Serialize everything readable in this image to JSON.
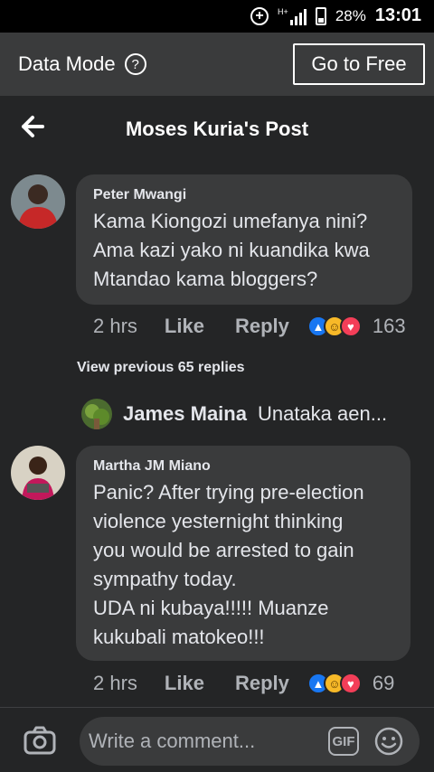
{
  "status_bar": {
    "network": "H+",
    "battery": "28%",
    "time": "13:01"
  },
  "data_bar": {
    "label": "Data Mode",
    "help_glyph": "?",
    "go_free": "Go to Free"
  },
  "header": {
    "title": "Moses Kuria's Post"
  },
  "comments": [
    {
      "author": "Peter Mwangi",
      "lines": [
        "Kama Kiongozi umefanya nini?",
        "Ama kazi yako ni kuandika kwa",
        "Mtandao kama bloggers?"
      ],
      "time": "2 hrs",
      "like": "Like",
      "reply": "Reply",
      "reaction_count": "163"
    },
    {
      "author": "Martha JM Miano",
      "lines": [
        "Panic? After trying pre-election",
        "violence yesternight thinking",
        "you would be arrested to gain",
        "sympathy today.",
        "UDA ni kubaya!!!!! Muanze",
        "kukubali matokeo!!!"
      ],
      "time": "2 hrs",
      "like": "Like",
      "reply": "Reply",
      "reaction_count": "69"
    }
  ],
  "view_previous": "View previous 65 replies",
  "reply_preview": {
    "author": "James Maina",
    "snippet": "Unataka aen..."
  },
  "composer": {
    "placeholder": "Write a comment...",
    "gif_label": "GIF"
  },
  "colors": {
    "background": "#242526",
    "bubble": "#3a3b3c",
    "like_blue": "#1877f2",
    "love_red": "#f33e58",
    "haha_yellow": "#f7b928"
  },
  "icons": [
    "plus-circle-icon",
    "signal-icon",
    "battery-icon",
    "help-icon",
    "back-arrow-icon",
    "like-reaction-icon",
    "haha-reaction-icon",
    "love-reaction-icon",
    "camera-icon",
    "gif-icon",
    "emoji-icon"
  ]
}
